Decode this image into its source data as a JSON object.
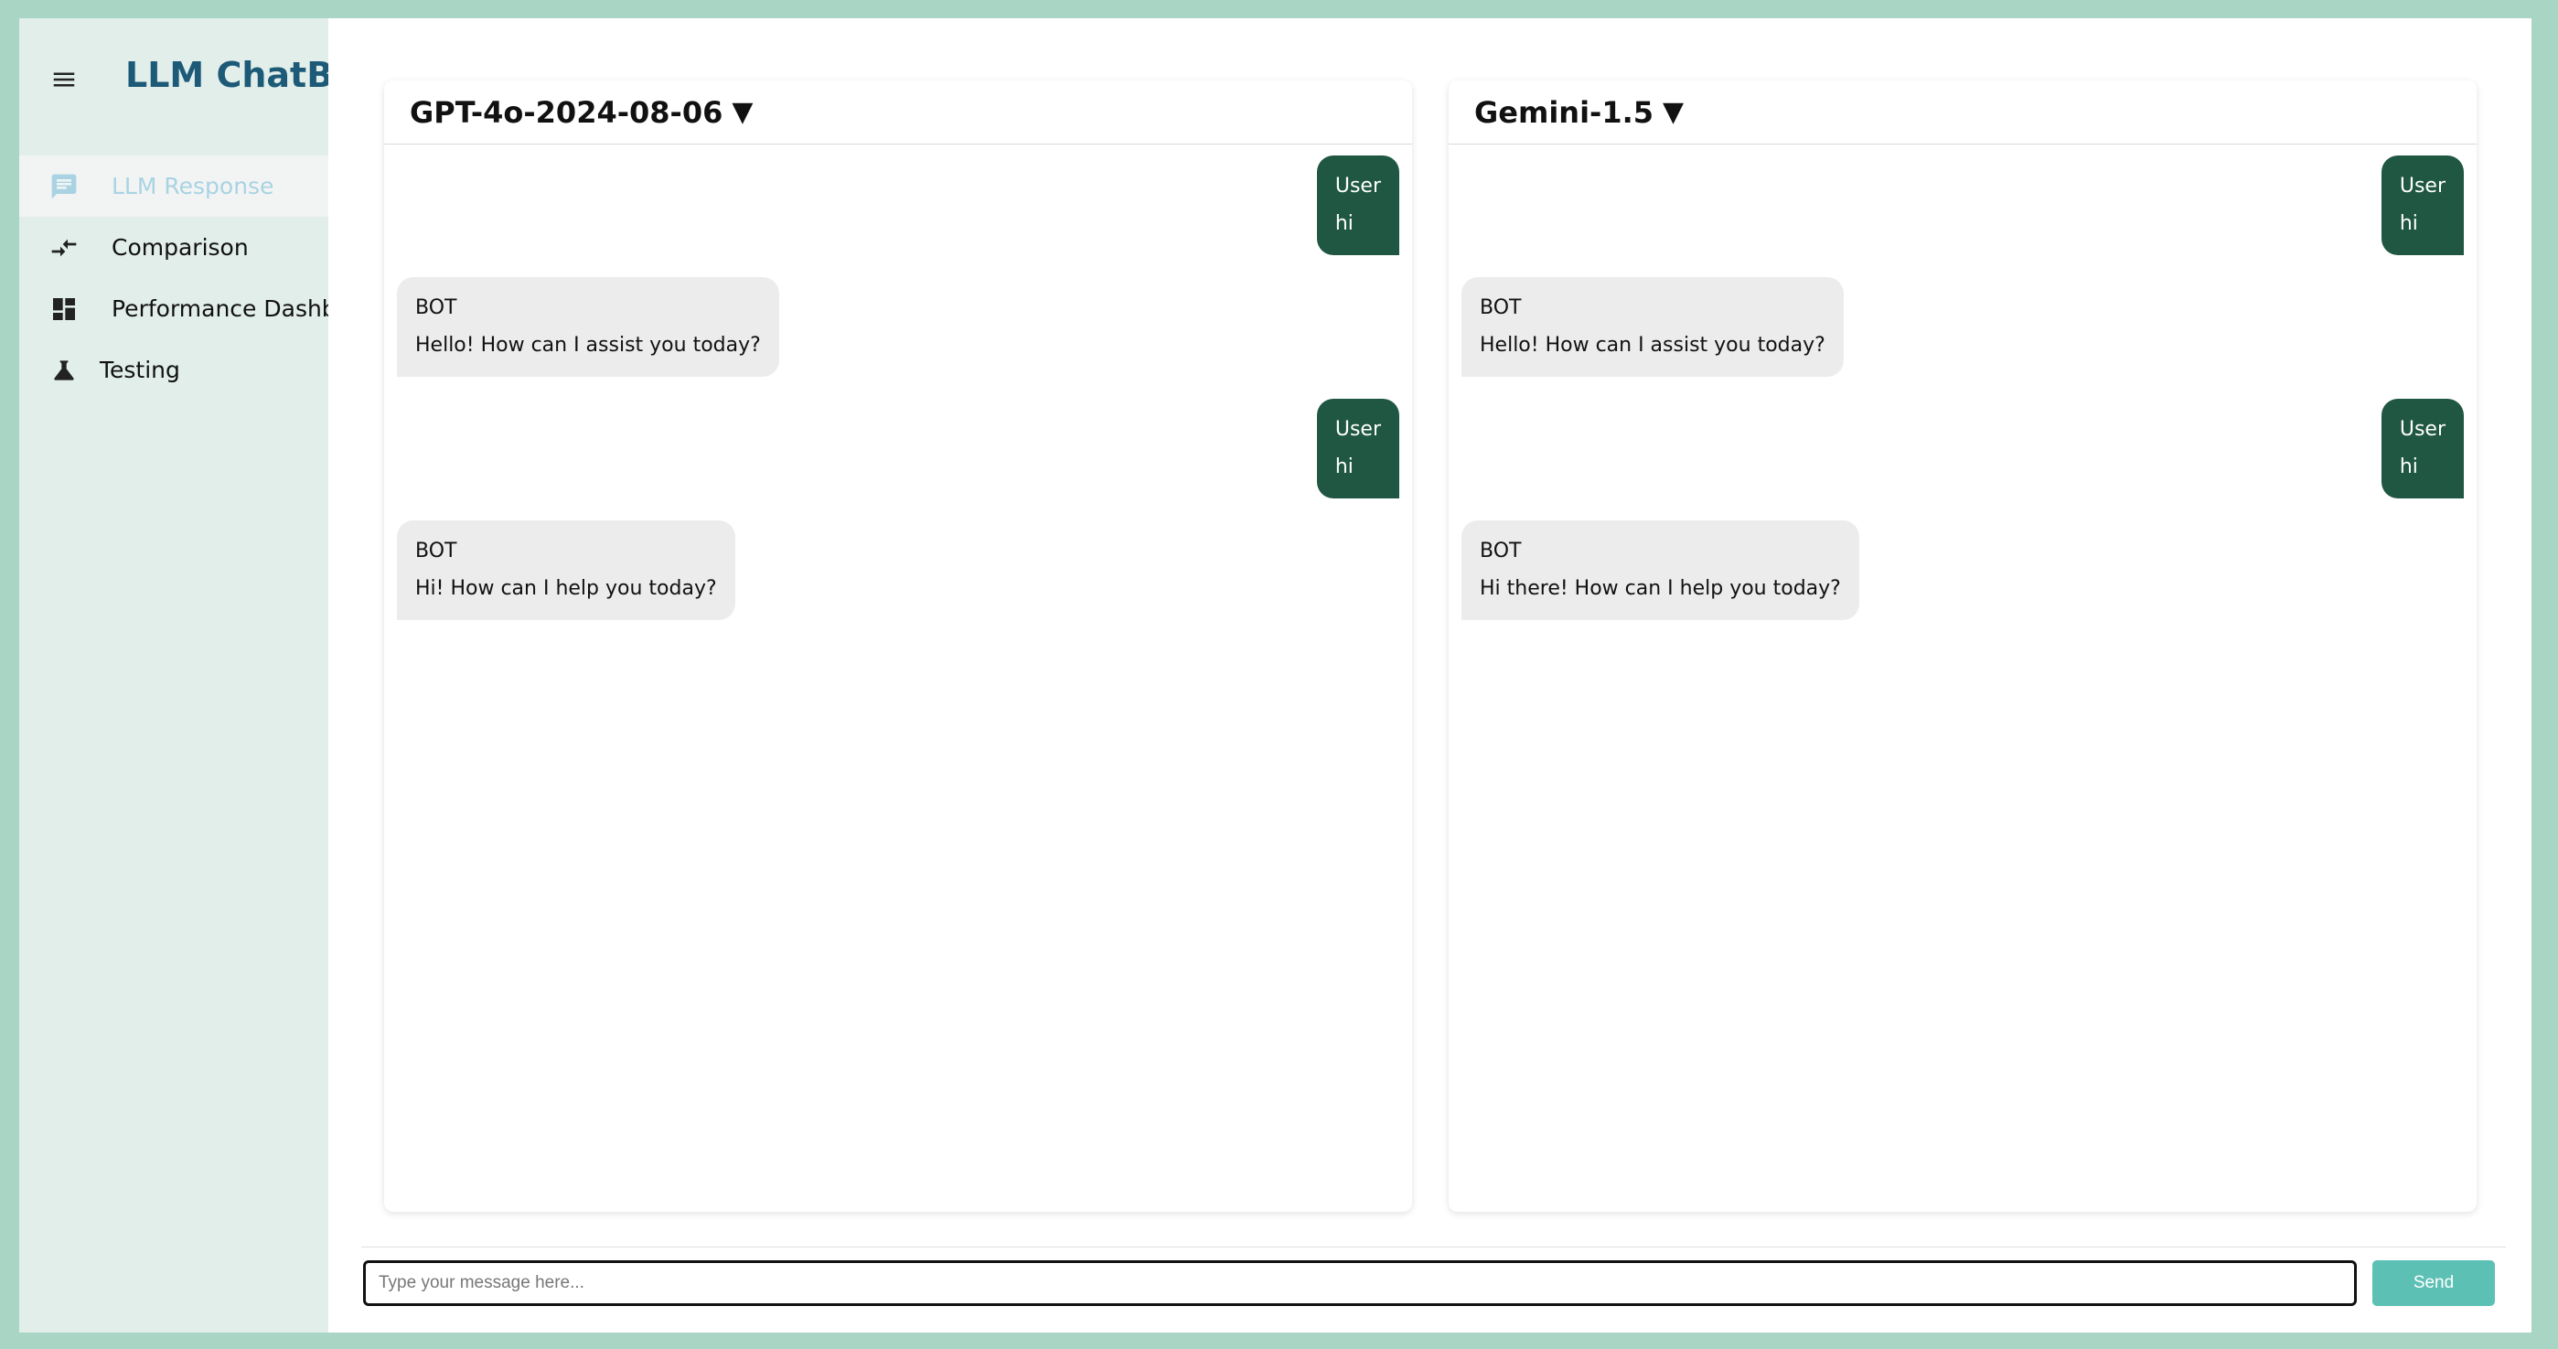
{
  "sidebar": {
    "brand": "LLM ChatBot",
    "items": [
      {
        "label": "LLM Response",
        "icon": "chat-icon",
        "active": true
      },
      {
        "label": "Comparison",
        "icon": "compare-arrows-icon"
      },
      {
        "label": "Performance Dashboard",
        "icon": "dashboard-icon"
      },
      {
        "label": "Testing",
        "icon": "flask-icon"
      }
    ]
  },
  "panels": [
    {
      "model": "GPT-4o-2024-08-06",
      "messages": [
        {
          "role": "user",
          "sender": "User",
          "text": "hi"
        },
        {
          "role": "bot",
          "sender": "BOT",
          "text": "Hello! How can I assist you today?"
        },
        {
          "role": "user",
          "sender": "User",
          "text": "hi"
        },
        {
          "role": "bot",
          "sender": "BOT",
          "text": "Hi! How can I help you today?"
        }
      ]
    },
    {
      "model": "Gemini-1.5",
      "messages": [
        {
          "role": "user",
          "sender": "User",
          "text": "hi"
        },
        {
          "role": "bot",
          "sender": "BOT",
          "text": "Hello! How can I assist you today?"
        },
        {
          "role": "user",
          "sender": "User",
          "text": "hi"
        },
        {
          "role": "bot",
          "sender": "BOT",
          "text": "Hi there! How can I help you today?"
        }
      ]
    }
  ],
  "composer": {
    "placeholder": "Type your message here...",
    "send_label": "Send"
  },
  "colors": {
    "frame": "#a9d5c4",
    "sidebar_bg": "#e1eeea",
    "brand": "#1d5a78",
    "user_bubble": "#1f5742",
    "bot_bubble": "#ececec",
    "send_button": "#5cc0b4"
  }
}
